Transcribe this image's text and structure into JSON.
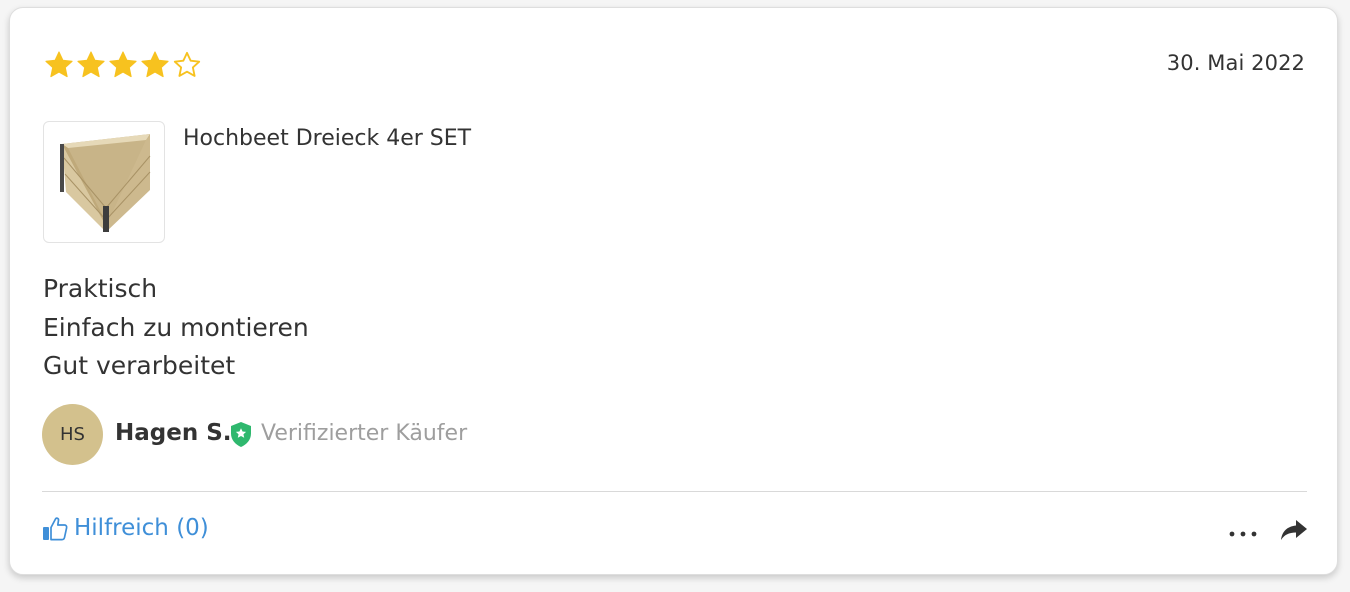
{
  "review": {
    "rating": 4,
    "rating_max": 5,
    "date": "30. Mai 2022",
    "product": {
      "name": "Hochbeet Dreieck 4er SET",
      "image_icon": "triangular-raised-bed-image"
    },
    "body_lines": [
      "Praktisch",
      "Einfach zu montieren",
      "Gut verarbeitet"
    ],
    "author": {
      "initials": "HS",
      "name": "Hagen S.",
      "verified_label": "Verifizierter Käufer"
    },
    "actions": {
      "helpful_label": "Hilfreich (0)",
      "more_icon": "more-dots-icon",
      "share_icon": "share-arrow-icon"
    }
  },
  "colors": {
    "star": "#f7c21f",
    "link": "#3f8fd8",
    "verified": "#2fb86e",
    "avatar_bg": "#d3c18d",
    "text": "#333333",
    "muted": "#9e9e9e"
  }
}
